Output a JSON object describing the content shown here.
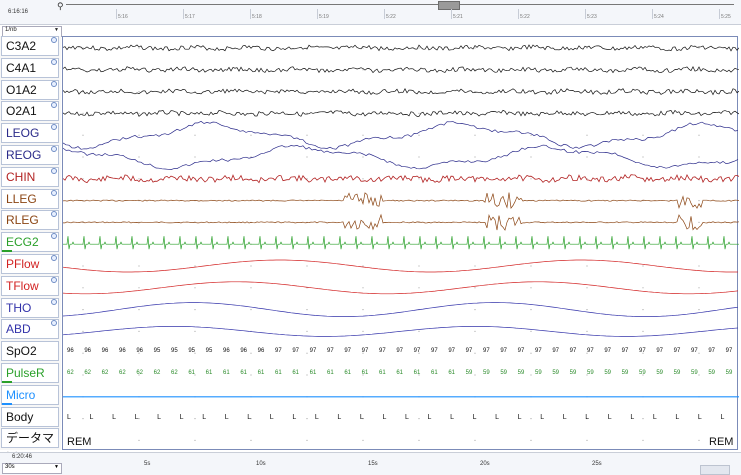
{
  "header": {
    "start_time": "6:16:16",
    "scale": "1/nb",
    "ruler_labels": [
      "5:16",
      "5:17",
      "5:18",
      "5:19",
      "5:22",
      "5:21",
      "5:22",
      "5:23",
      "5:24",
      "5:25"
    ]
  },
  "channels": [
    {
      "name": "C3A2",
      "color": "#111111"
    },
    {
      "name": "C4A1",
      "color": "#111111"
    },
    {
      "name": "O1A2",
      "color": "#111111"
    },
    {
      "name": "O2A1",
      "color": "#111111"
    },
    {
      "name": "LEOG",
      "color": "#2a2a8a"
    },
    {
      "name": "REOG",
      "color": "#2a2a8a"
    },
    {
      "name": "CHIN",
      "color": "#b22222"
    },
    {
      "name": "LLEG",
      "color": "#8b4513"
    },
    {
      "name": "RLEG",
      "color": "#8b4513"
    },
    {
      "name": "ECG2",
      "color": "#2aa02a"
    },
    {
      "name": "PFlow",
      "color": "#d22222"
    },
    {
      "name": "TFlow",
      "color": "#d22222"
    },
    {
      "name": "THO",
      "color": "#3333aa"
    },
    {
      "name": "ABD",
      "color": "#3333aa"
    },
    {
      "name": "SpO2",
      "color": "#111111"
    },
    {
      "name": "PulseR",
      "color": "#2aa02a"
    },
    {
      "name": "Micro",
      "color": "#1e90ff"
    },
    {
      "name": "Body",
      "color": "#111111"
    },
    {
      "name": "データマー",
      "color": "#111111"
    }
  ],
  "spo2": [
    "96",
    "96",
    "96",
    "96",
    "96",
    "95",
    "95",
    "95",
    "95",
    "96",
    "96",
    "96",
    "97",
    "97",
    "97",
    "97",
    "97",
    "97",
    "97",
    "97",
    "97",
    "97",
    "97",
    "97",
    "97",
    "97",
    "97",
    "97",
    "97",
    "97",
    "97",
    "97",
    "97",
    "97",
    "97",
    "97",
    "97",
    "97",
    "97"
  ],
  "pulse": [
    "62",
    "62",
    "62",
    "62",
    "62",
    "62",
    "62",
    "61",
    "61",
    "61",
    "61",
    "61",
    "61",
    "61",
    "61",
    "61",
    "61",
    "61",
    "61",
    "61",
    "61",
    "61",
    "61",
    "59",
    "59",
    "59",
    "59",
    "59",
    "59",
    "59",
    "59",
    "59",
    "59",
    "59",
    "59",
    "59",
    "59",
    "59",
    "59"
  ],
  "body_marker": "L",
  "stage": {
    "left": "REM",
    "right": "REM"
  },
  "footer": {
    "end_time": "6:20:46",
    "scale": "30s",
    "seconds": [
      "5s",
      "10s",
      "15s",
      "20s",
      "25s"
    ]
  }
}
